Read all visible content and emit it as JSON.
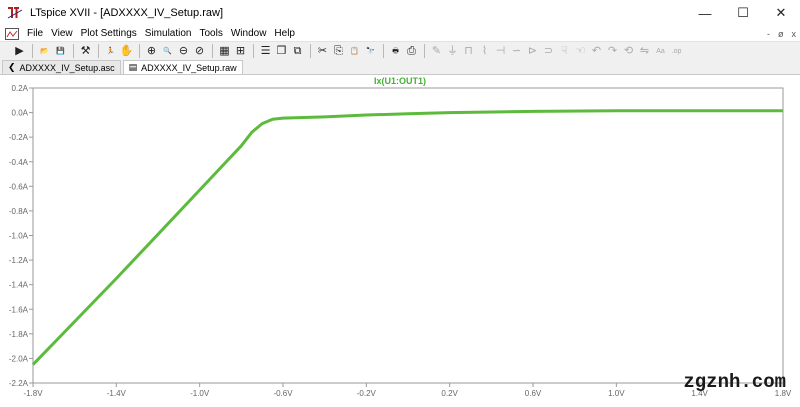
{
  "window": {
    "title": "LTspice XVII - [ADXXXX_IV_Setup.raw]",
    "minimize": "—",
    "maximize": "☐",
    "close": "✕"
  },
  "menu": {
    "items": [
      "File",
      "View",
      "Plot Settings",
      "Simulation",
      "Tools",
      "Window",
      "Help"
    ],
    "mdi_minimize": "-",
    "mdi_restore": "ø",
    "mdi_close": "x"
  },
  "toolbar": {
    "buttons": [
      {
        "icon": "run-icon",
        "glyph": "▶"
      },
      {
        "icon": "open-folder-icon",
        "glyph": "📂"
      },
      {
        "icon": "save-icon",
        "glyph": "💾"
      },
      {
        "icon": "control-panel-icon",
        "glyph": "⚒"
      },
      {
        "icon": "run-man-icon",
        "glyph": "🏃"
      },
      {
        "icon": "hand-pan-icon",
        "glyph": "✋"
      },
      {
        "icon": "zoom-in-icon",
        "glyph": "⊕"
      },
      {
        "icon": "zoom-icon",
        "glyph": "🔍"
      },
      {
        "icon": "zoom-out-icon",
        "glyph": "⊖"
      },
      {
        "icon": "zoom-cancel-icon",
        "glyph": "⊘"
      },
      {
        "icon": "autorange-icon",
        "glyph": "▦"
      },
      {
        "icon": "fit-icon",
        "glyph": "⊞"
      },
      {
        "icon": "tile-horizontal-icon",
        "glyph": "☰"
      },
      {
        "icon": "cascade-icon",
        "glyph": "❐"
      },
      {
        "icon": "tile-vertical-icon",
        "glyph": "⧉"
      },
      {
        "icon": "cut-icon",
        "glyph": "✂"
      },
      {
        "icon": "copy-icon",
        "glyph": "⎘"
      },
      {
        "icon": "paste-icon",
        "glyph": "📋"
      },
      {
        "icon": "find-icon",
        "glyph": "🔭"
      },
      {
        "icon": "print-preview-icon",
        "glyph": "🖶"
      },
      {
        "icon": "print-icon",
        "glyph": "⎙"
      },
      {
        "icon": "wire-icon",
        "glyph": "✎",
        "gray": true
      },
      {
        "icon": "ground-icon",
        "glyph": "⏚",
        "gray": true
      },
      {
        "icon": "label-icon",
        "glyph": "⊓",
        "gray": true
      },
      {
        "icon": "resistor-icon",
        "glyph": "⌇",
        "gray": true
      },
      {
        "icon": "capacitor-icon",
        "glyph": "⊣",
        "gray": true
      },
      {
        "icon": "inductor-icon",
        "glyph": "∽",
        "gray": true
      },
      {
        "icon": "diode-icon",
        "glyph": "⊳",
        "gray": true
      },
      {
        "icon": "component-icon",
        "glyph": "⊃",
        "gray": true
      },
      {
        "icon": "move-hand-icon",
        "glyph": "☟",
        "gray": true
      },
      {
        "icon": "drag-hand-icon",
        "glyph": "☜",
        "gray": true
      },
      {
        "icon": "undo-icon",
        "glyph": "↶",
        "gray": true
      },
      {
        "icon": "redo-icon",
        "glyph": "↷",
        "gray": true
      },
      {
        "icon": "rotate-icon",
        "glyph": "⟲",
        "gray": true
      },
      {
        "icon": "mirror-icon",
        "glyph": "⇋",
        "gray": true
      },
      {
        "icon": "text-icon",
        "glyph": "Aa",
        "gray": true
      },
      {
        "icon": "spice-directive-icon",
        "glyph": ".op",
        "gray": true
      }
    ]
  },
  "tabs": [
    {
      "label": "ADXXXX_IV_Setup.asc",
      "icon": "schematic-icon",
      "active": false
    },
    {
      "label": "ADXXXX_IV_Setup.raw",
      "icon": "waveform-icon",
      "active": true
    }
  ],
  "plot": {
    "trace_label": "Ix(U1:OUT1)"
  },
  "chart_data": {
    "type": "line",
    "title": "Ix(U1:OUT1)",
    "xlabel": "",
    "ylabel": "",
    "x_ticks": [
      "-1.8V",
      "-1.4V",
      "-1.0V",
      "-0.6V",
      "-0.2V",
      "0.2V",
      "0.6V",
      "1.0V",
      "1.4V",
      "1.8V"
    ],
    "y_ticks": [
      "0.2A",
      "0.0A",
      "-0.2A",
      "-0.4A",
      "-0.6A",
      "-0.8A",
      "-1.0A",
      "-1.2A",
      "-1.4A",
      "-1.6A",
      "-1.8A",
      "-2.0A",
      "-2.2A"
    ],
    "xlim": [
      -1.8,
      1.8
    ],
    "ylim": [
      -2.2,
      0.2
    ],
    "grid": false,
    "series": [
      {
        "name": "Ix(U1:OUT1)",
        "color": "#5cba3c",
        "x": [
          -1.8,
          -1.6,
          -1.4,
          -1.2,
          -1.0,
          -0.9,
          -0.8,
          -0.75,
          -0.7,
          -0.65,
          -0.6,
          -0.5,
          -0.4,
          -0.2,
          0.0,
          0.2,
          0.6,
          1.0,
          1.4,
          1.8
        ],
        "y": [
          -2.05,
          -1.7,
          -1.35,
          -0.99,
          -0.63,
          -0.45,
          -0.27,
          -0.16,
          -0.09,
          -0.055,
          -0.045,
          -0.04,
          -0.035,
          -0.02,
          -0.01,
          0.0,
          0.01,
          0.015,
          0.015,
          0.015
        ]
      }
    ]
  },
  "watermark": "zgznh.com"
}
